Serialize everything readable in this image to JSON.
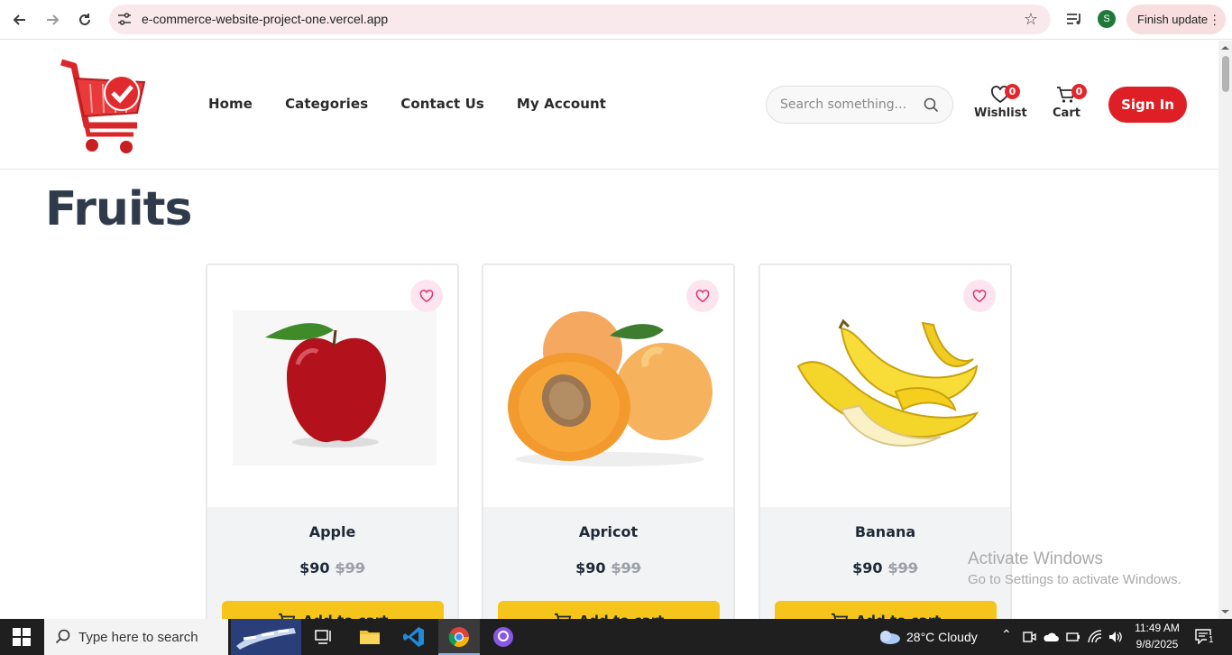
{
  "browser": {
    "url": "e-commerce-website-project-one.vercel.app",
    "profile_initial": "S",
    "finish_update_label": "Finish update"
  },
  "nav": {
    "items": [
      "Home",
      "Categories",
      "Contact Us",
      "My Account"
    ]
  },
  "search": {
    "placeholder": "Search something..."
  },
  "wishlist": {
    "label": "Wishlist",
    "count": "0"
  },
  "cart": {
    "label": "Cart",
    "count": "0"
  },
  "signin_label": "Sign In",
  "page_title": "Fruits",
  "products": [
    {
      "name": "Apple",
      "price": "$90",
      "old_price": "$99",
      "button": "Add to cart"
    },
    {
      "name": "Apricot",
      "price": "$90",
      "old_price": "$99",
      "button": "Add to cart"
    },
    {
      "name": "Banana",
      "price": "$90",
      "old_price": "$99",
      "button": "Add to cart"
    }
  ],
  "watermark": {
    "line1": "Activate Windows",
    "line2": "Go to Settings to activate Windows."
  },
  "taskbar": {
    "search_placeholder": "Type here to search",
    "weather": "28°C  Cloudy",
    "time": "11:49 AM",
    "date": "9/8/2025",
    "notifications": "1"
  },
  "colors": {
    "brand_red": "#de1f26",
    "button_yellow": "#f5c51b",
    "heart_bg": "#fde4ee"
  }
}
